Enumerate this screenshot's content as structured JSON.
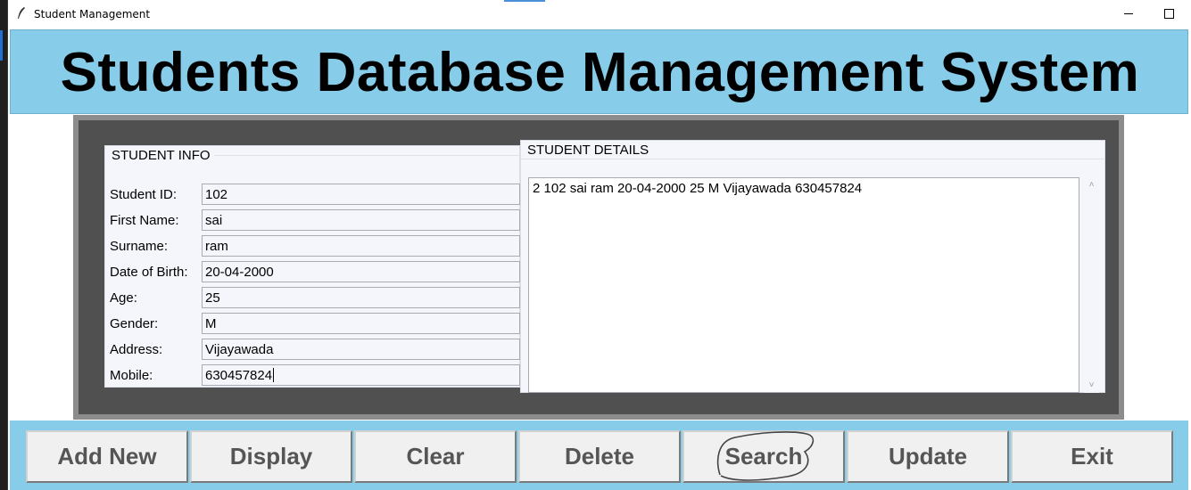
{
  "window": {
    "title": "Student Management",
    "controls": [
      "minimize",
      "maximize"
    ]
  },
  "header": {
    "title": "Students Database Management System",
    "background": "#87cce8"
  },
  "student_info": {
    "frame_title": "STUDENT INFO",
    "fields": [
      {
        "label": "Student ID:",
        "value": "102"
      },
      {
        "label": "First Name:",
        "value": "sai"
      },
      {
        "label": "Surname:",
        "value": "ram"
      },
      {
        "label": "Date of Birth:",
        "value": "20-04-2000"
      },
      {
        "label": "Age:",
        "value": "25"
      },
      {
        "label": "Gender:",
        "value": "M"
      },
      {
        "label": "Address:",
        "value": "Vijayawada"
      },
      {
        "label": "Mobile:",
        "value": "630457824"
      }
    ]
  },
  "student_details": {
    "frame_title": "STUDENT DETAILS",
    "records": [
      "2 102 sai ram 20-04-2000 25 M Vijayawada 630457824"
    ]
  },
  "buttons": [
    "Add New",
    "Display",
    "Clear",
    "Delete",
    "Search",
    "Update",
    "Exit"
  ],
  "colors": {
    "accent": "#87cce8",
    "frame_dark": "#505050",
    "frame_border": "#8c8c8c",
    "button_text": "#555555"
  },
  "icons": {
    "app": "feather-icon",
    "minimize": "minimize-icon",
    "maximize": "maximize-icon",
    "scroll_up": "chevron-up-icon",
    "scroll_down": "chevron-down-icon"
  }
}
